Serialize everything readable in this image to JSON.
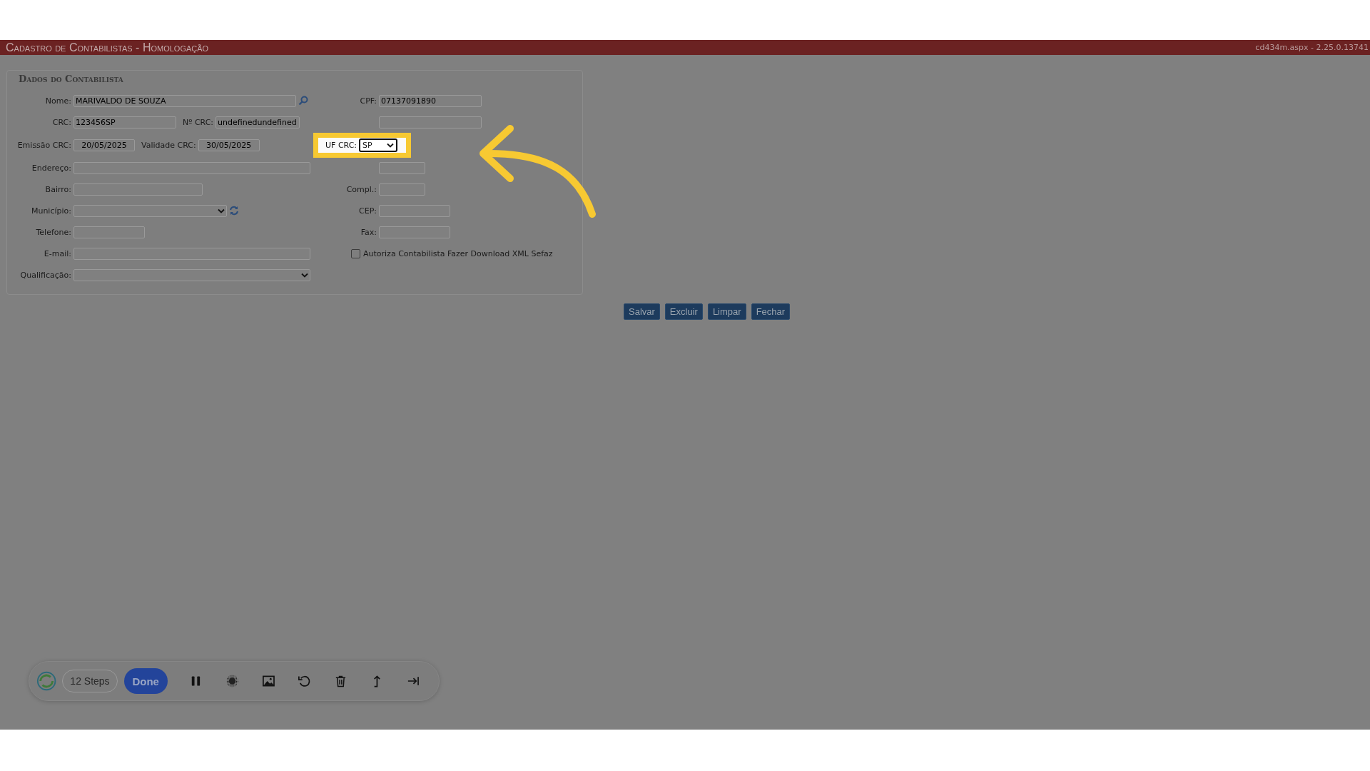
{
  "header": {
    "title": "Cadastro de Contabilistas  - Homologação",
    "version": "cd434m.aspx - 2.25.0.13741"
  },
  "form": {
    "legend": "Dados do Contabilista",
    "rows": [
      {
        "left": [
          {
            "kind": "text",
            "label": "Nome:",
            "value": "MARIVALDO DE SOUZA",
            "search_button": true
          }
        ],
        "right": [
          {
            "kind": "text",
            "label": "CPF:",
            "value": "07137091890"
          }
        ]
      },
      {
        "left": [
          {
            "kind": "text",
            "label": "CRC:",
            "value": "123456SP"
          },
          {
            "kind": "text",
            "label": "Nº CRC:",
            "value": "undefinedundefined"
          }
        ],
        "right": [
          {
            "kind": "text"
          }
        ]
      },
      {
        "left": [
          {
            "kind": "date",
            "label": "Emissão CRC:",
            "value": "20/05/2025"
          },
          {
            "kind": "date",
            "label": "Validade CRC:",
            "value": "30/05/2025"
          }
        ],
        "right": [
          {
            "kind": "select",
            "label": "UF CRC:",
            "value": "SP",
            "highlighted": true
          }
        ]
      },
      {
        "left": [
          {
            "kind": "text",
            "label": "Endereço:"
          }
        ],
        "right": [
          {
            "kind": "text"
          }
        ]
      },
      {
        "left": [
          {
            "kind": "text",
            "label": "Bairro:"
          }
        ],
        "right": [
          {
            "kind": "text",
            "label": "Compl.:"
          }
        ]
      },
      {
        "left": [
          {
            "kind": "select",
            "label": "Município:",
            "refresh_button": true
          }
        ],
        "right": [
          {
            "kind": "text",
            "label": "CEP:"
          }
        ]
      },
      {
        "left": [
          {
            "kind": "text",
            "label": "Telefone:"
          }
        ],
        "right": [
          {
            "kind": "text",
            "label": "Fax:"
          }
        ]
      },
      {
        "left": [
          {
            "kind": "text",
            "label": "E-mail:"
          }
        ],
        "right": [
          {
            "kind": "checkbox",
            "label": "Autoriza Contabilista Fazer Download XML Sefaz",
            "checked": false
          }
        ]
      },
      {
        "left": [
          {
            "kind": "select",
            "label": "Qualificação:"
          }
        ],
        "right": []
      }
    ]
  },
  "buttons": [
    "Salvar",
    "Excluir",
    "Limpar",
    "Fechar"
  ],
  "recorder": {
    "steps": "12 Steps",
    "done": "Done"
  }
}
